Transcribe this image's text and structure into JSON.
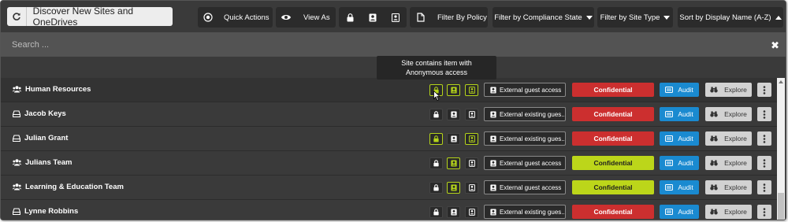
{
  "toolbar": {
    "discover_label": "Discover New Sites and OneDrives",
    "quick_actions_label": "Quick Actions",
    "view_as_label": "View As",
    "filter_policy_label": "Filter By Policy",
    "filter_compliance_label": "Filter by Compliance State",
    "filter_site_type_label": "Filter by Site Type",
    "sort_label": "Sort by Display Name (A-Z)"
  },
  "search": {
    "placeholder": "Search ..."
  },
  "tooltip": {
    "line1": "Site contains item with",
    "line2": "Anonymous access"
  },
  "colors": {
    "confidential": "#cc2f2f",
    "green_label": "#bcd61a",
    "audit": "#1a8ad0",
    "access_active": "#b5d41a"
  },
  "rows": [
    {
      "name": "Human Resources",
      "type_icon": "group-icon",
      "access": [
        true,
        true,
        true
      ],
      "sharing": "External guest access",
      "label": "Confidential",
      "label_color": "red",
      "audit": "Audit",
      "explore": "Explore"
    },
    {
      "name": "Jacob Keys",
      "type_icon": "drive-icon",
      "access": [
        false,
        false,
        false
      ],
      "sharing": "External existing gues...",
      "label": "Confidential",
      "label_color": "red",
      "audit": "Audit",
      "explore": "Explore"
    },
    {
      "name": "Julian Grant",
      "type_icon": "drive-icon",
      "access": [
        true,
        false,
        true
      ],
      "sharing": "External existing gues...",
      "label": "Confidential",
      "label_color": "red",
      "audit": "Audit",
      "explore": "Explore"
    },
    {
      "name": "Julians Team",
      "type_icon": "group-icon",
      "access": [
        false,
        true,
        false
      ],
      "sharing": "External guest access",
      "label": "Confidential",
      "label_color": "green",
      "audit": "Audit",
      "explore": "Explore"
    },
    {
      "name": "Learning & Education Team",
      "type_icon": "group-icon",
      "access": [
        false,
        true,
        false
      ],
      "sharing": "External guest access",
      "label": "Confidential",
      "label_color": "green",
      "audit": "Audit",
      "explore": "Explore"
    },
    {
      "name": "Lynne Robbins",
      "type_icon": "drive-icon",
      "access": [
        false,
        false,
        false
      ],
      "sharing": "External existing gues...",
      "label": "Confidential",
      "label_color": "red",
      "audit": "Audit",
      "explore": "Explore"
    }
  ]
}
